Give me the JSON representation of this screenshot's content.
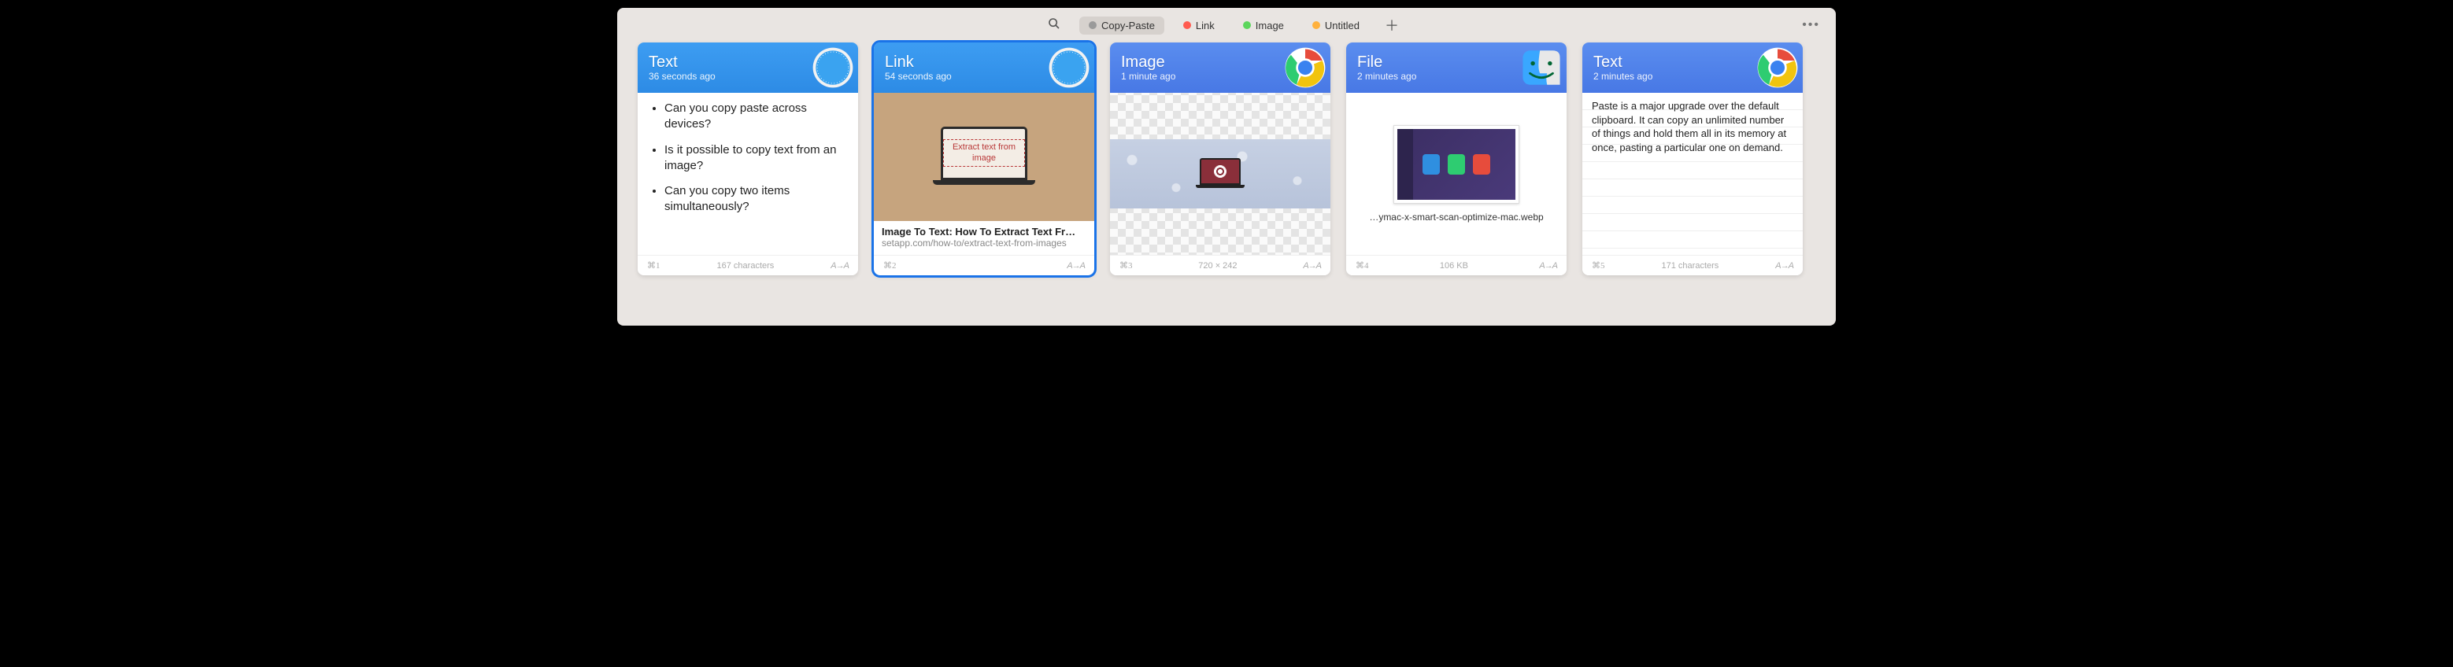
{
  "toolbar": {
    "tabs": [
      {
        "label": "Copy-Paste",
        "color": "#9a9a9a",
        "active": true
      },
      {
        "label": "Link",
        "color": "#ff5b4f",
        "active": false
      },
      {
        "label": "Image",
        "color": "#5cd65c",
        "active": false
      },
      {
        "label": "Untitled",
        "color": "#ffb13d",
        "active": false
      }
    ]
  },
  "cards": [
    {
      "type": "Text",
      "time": "36 seconds ago",
      "app": "safari",
      "headerClass": "hdr-safari",
      "selected": false,
      "bullets": [
        "Can you copy paste across devices?",
        "Is it possible to copy text from an image?",
        "Can you copy two items simultaneously?"
      ],
      "shortcut": "⌘1",
      "meta": "167 characters"
    },
    {
      "type": "Link",
      "time": "54 seconds ago",
      "app": "safari",
      "headerClass": "hdr-safari",
      "selected": true,
      "link_preview_text": "Extract text from image",
      "link_title": "Image To Text: How To Extract Text Fr…",
      "link_url": "setapp.com/how-to/extract-text-from-images",
      "shortcut": "⌘2",
      "meta": ""
    },
    {
      "type": "Image",
      "time": "1 minute ago",
      "app": "chrome",
      "headerClass": "hdr-chrome",
      "selected": false,
      "shortcut": "⌘3",
      "meta": "720 × 242"
    },
    {
      "type": "File",
      "time": "2 minutes ago",
      "app": "finder",
      "headerClass": "hdr-finder",
      "selected": false,
      "filename": "…ymac-x-smart-scan-optimize-mac.webp",
      "shortcut": "⌘4",
      "meta": "106 KB"
    },
    {
      "type": "Text",
      "time": "2 minutes ago",
      "app": "chrome",
      "headerClass": "hdr-chrome",
      "selected": false,
      "paragraph": "Paste is a major upgrade over the default clipboard. It can copy an unlimited number of things and hold them all in its memory at once, pasting a particular one on demand.",
      "shortcut": "⌘5",
      "meta": "171 characters"
    }
  ],
  "aa_glyph": "A→A"
}
